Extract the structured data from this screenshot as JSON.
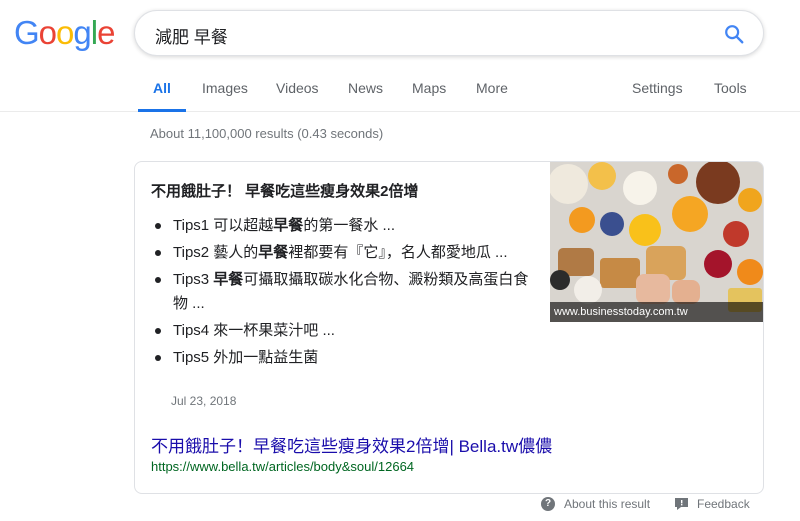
{
  "logo": {
    "letters": [
      "G",
      "o",
      "o",
      "g",
      "l",
      "e"
    ],
    "colors": [
      "#4285F4",
      "#EA4335",
      "#FBBC05",
      "#4285F4",
      "#34A853",
      "#EA4335"
    ]
  },
  "search": {
    "query": "減肥 早餐",
    "icon": "search-icon"
  },
  "tabs": {
    "all": "All",
    "images": "Images",
    "videos": "Videos",
    "news": "News",
    "maps": "Maps",
    "more": "More",
    "settings": "Settings",
    "tools": "Tools"
  },
  "result_stats": "About 11,100,000 results (0.43 seconds)",
  "snippet": {
    "title": "不用餓肚子！ 早餐吃這些瘦身效果2倍增",
    "tips": [
      {
        "pre": "Tips1 可以超越",
        "bold": "早餐",
        "post": "的第一餐水 ..."
      },
      {
        "pre": "Tips2 藝人的",
        "bold": "早餐",
        "post": "裡都要有『它』，名人都愛地瓜 ..."
      },
      {
        "pre": "Tips3 ",
        "bold": "早餐",
        "post": "可攝取攝取碳水化合物、澱粉類及高蛋白食物 ..."
      },
      {
        "pre": "Tips4 來一杯果菜汁吧 ...",
        "bold": "",
        "post": ""
      },
      {
        "pre": "Tips5 外加一點益生菌",
        "bold": "",
        "post": ""
      }
    ],
    "date": "Jul 23, 2018",
    "image_caption": "www.businesstoday.com.tw",
    "link_title": "不用餓肚子！早餐吃這些瘦身效果2倍增| Bella.tw儂儂",
    "link_url": "https://www.bella.tw/articles/body&soul/12664"
  },
  "footer": {
    "about": "About this result",
    "feedback": "Feedback"
  },
  "colors": {
    "accent": "#1a73e8",
    "link": "#1a0dab",
    "url": "#006621",
    "muted": "#70757a"
  }
}
